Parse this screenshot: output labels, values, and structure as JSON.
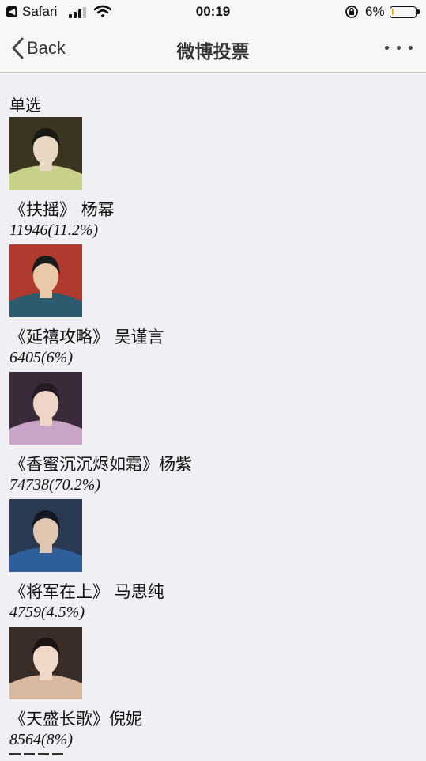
{
  "status_bar": {
    "back_app": "Safari",
    "time": "00:19",
    "battery": "6%",
    "battery_level": 0.06,
    "icons": [
      "back-to-app-icon",
      "signal-icon",
      "wifi-icon",
      "rotation-lock-icon",
      "battery-icon"
    ]
  },
  "nav": {
    "back_label": "Back",
    "title": "微博投票",
    "icons": [
      "chevron-left-icon",
      "more-icon"
    ]
  },
  "poll": {
    "type_label": "单选",
    "options": [
      {
        "label": "《扶摇》 杨幂",
        "result": "11946(11.2%)",
        "votes": 11946,
        "percent": 11.2,
        "thumb_colors": [
          "#3a3420",
          "#c9d08a",
          "#e8d7c2",
          "#1a1a14"
        ]
      },
      {
        "label": "《延禧攻略》 吴谨言",
        "result": "6405(6%)",
        "votes": 6405,
        "percent": 6,
        "thumb_colors": [
          "#b03a2e",
          "#2c5a6e",
          "#e9c9a8",
          "#1b1b1b"
        ]
      },
      {
        "label": "《香蜜沉沉烬如霜》杨紫",
        "result": "74738(70.2%)",
        "votes": 74738,
        "percent": 70.2,
        "thumb_colors": [
          "#3b2a3a",
          "#c9a6c8",
          "#eed5c8",
          "#241a22"
        ]
      },
      {
        "label": "《将军在上》 马思纯",
        "result": "4759(4.5%)",
        "votes": 4759,
        "percent": 4.5,
        "thumb_colors": [
          "#2a3a52",
          "#2f5f9a",
          "#e2c7b0",
          "#111820"
        ]
      },
      {
        "label": "《天盛长歌》倪妮",
        "result": "8564(8%)",
        "votes": 8564,
        "percent": 8,
        "thumb_colors": [
          "#3a2c26",
          "#d9b8a0",
          "#f0d8c8",
          "#1b1412"
        ]
      }
    ]
  }
}
